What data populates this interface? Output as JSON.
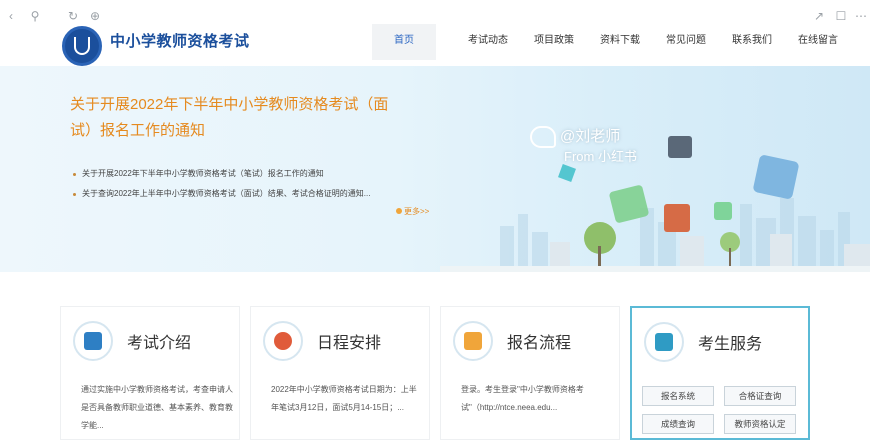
{
  "header": {
    "logo_text": "中小学教师资格考试",
    "nav": [
      "首页",
      "考试动态",
      "项目政策",
      "资料下载",
      "常见问题",
      "联系我们",
      "在线留言"
    ]
  },
  "banner": {
    "title": "关于开展2022年下半年中小学教师资格考试（面试）报名工作的通知",
    "items": [
      "关于开展2022年下半年中小学教师资格考试（笔试）报名工作的通知",
      "关于查询2022年上半年中小学教师资格考试（面试）结果、考试合格证明的通知..."
    ],
    "more": "更多>>",
    "watermark": [
      "@刘老师",
      "From 小红书"
    ]
  },
  "cards": [
    {
      "title": "考试介绍",
      "text": "通过实施中小学教师资格考试，考查申请人是否具备教师职业道德、基本素养、教育教学能..."
    },
    {
      "title": "日程安排",
      "text": "2022年中小学教师资格考试日期为：上半年笔试3月12日，面试5月14-15日；..."
    },
    {
      "title": "报名流程",
      "text": "登录。考生登录\"中小学教师资格考试\"（http://ntce.neea.edu..."
    },
    {
      "title": "考生服务",
      "buttons": [
        "报名系统",
        "合格证查询",
        "成绩查询",
        "教师资格认定"
      ]
    }
  ],
  "colors": {
    "brand_blue": "#1b4f9c",
    "accent_orange": "#e58a1f",
    "selected_border": "#5bbad6"
  }
}
